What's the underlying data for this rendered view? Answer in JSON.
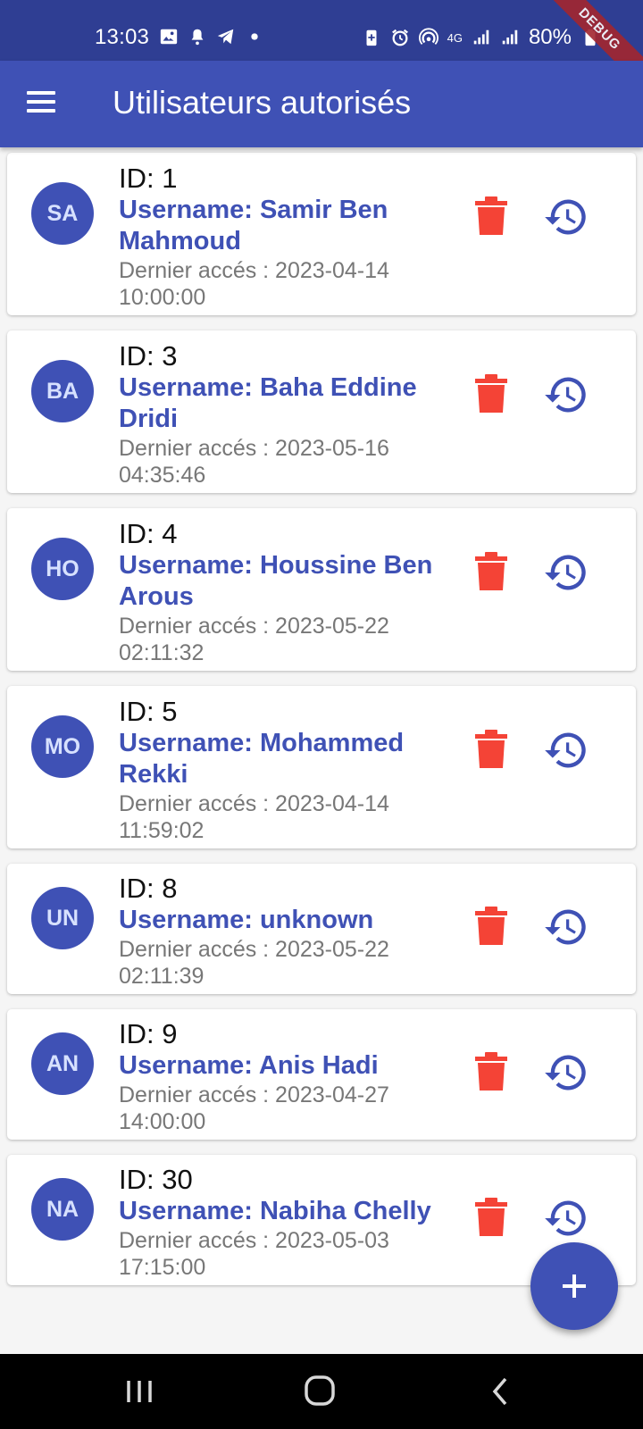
{
  "status_bar": {
    "time": "13:03",
    "battery": "80%",
    "network": "4G",
    "icons_left": [
      "gallery-icon",
      "notification-icon",
      "telegram-icon",
      "dot-icon"
    ],
    "icons_right": [
      "battery-saver-icon",
      "alarm-icon",
      "hotspot-icon",
      "data-icon",
      "signal-icon",
      "signal-icon",
      "battery-icon"
    ],
    "debug_banner": "DEBUG"
  },
  "app_bar": {
    "title": "Utilisateurs autorisés",
    "menu_icon": "menu-icon"
  },
  "users": [
    {
      "initials": "SA",
      "id": "ID: 1",
      "username": "Username: Samir Ben Mahmoud",
      "last_access": "Dernier accés : 2023-04-14 10:00:00"
    },
    {
      "initials": "BA",
      "id": "ID: 3",
      "username": "Username: Baha Eddine Dridi",
      "last_access": "Dernier accés : 2023-05-16 04:35:46"
    },
    {
      "initials": "HO",
      "id": "ID: 4",
      "username": "Username: Houssine Ben Arous",
      "last_access": "Dernier accés : 2023-05-22 02:11:32"
    },
    {
      "initials": "MO",
      "id": "ID: 5",
      "username": "Username: Mohammed Rekki",
      "last_access": "Dernier accés : 2023-04-14 11:59:02"
    },
    {
      "initials": "UN",
      "id": "ID: 8",
      "username": "Username: unknown",
      "last_access": "Dernier accés : 2023-05-22 02:11:39"
    },
    {
      "initials": "AN",
      "id": "ID: 9",
      "username": "Username: Anis Hadi",
      "last_access": "Dernier accés : 2023-04-27 14:00:00"
    },
    {
      "initials": "NA",
      "id": "ID: 30",
      "username": "Username: Nabiha Chelly",
      "last_access": "Dernier accés : 2023-05-03 17:15:00"
    }
  ],
  "colors": {
    "primary": "#3f51b5",
    "status_bar": "#2f3e93",
    "delete": "#f44336",
    "history": "#3f51b5",
    "avatar_text": "#d7e1ff"
  },
  "fab": {
    "icon": "add-icon"
  },
  "nav_bar": {
    "buttons": [
      "recents-icon",
      "home-icon",
      "back-icon"
    ]
  }
}
